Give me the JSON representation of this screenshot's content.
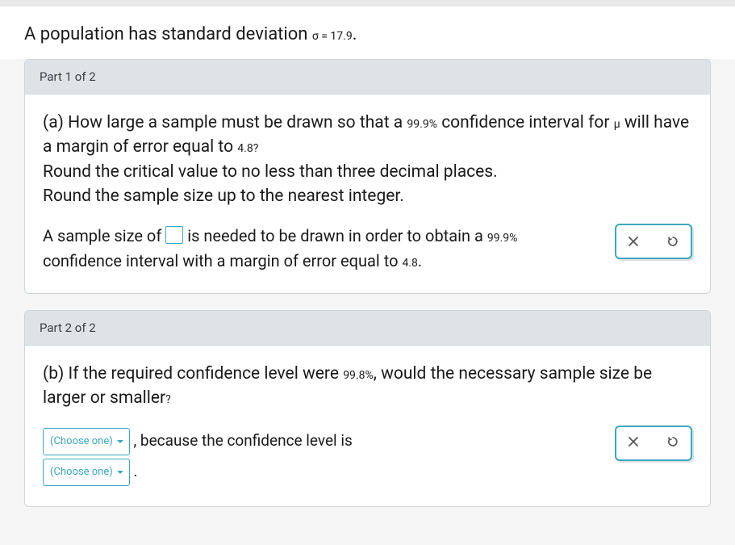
{
  "intro": {
    "prefix": "A population has standard deviation ",
    "sigma_expr": "σ = 17.9",
    "suffix": "."
  },
  "part1": {
    "header": "Part 1 of 2",
    "q_line1a": "(a) How large a sample must be drawn so that a ",
    "q_conf": "99.9%",
    "q_line1b": " confidence interval for ",
    "q_mu": "μ",
    "q_line1c": " will have a margin of error equal to ",
    "q_moe": "4.8?",
    "q_line2": "Round the critical value to no less than three decimal places.",
    "q_line3": "Round the sample size up to the nearest integer.",
    "ans_a": "A sample size of ",
    "ans_b": " is needed to be drawn in order to obtain a ",
    "ans_conf": "99.9%",
    "ans_c": " confidence interval with a margin of error equal to ",
    "ans_moe": "4.8",
    "ans_d": "."
  },
  "part2": {
    "header": "Part 2 of 2",
    "q_a": "(b) If the required confidence level were ",
    "q_conf": "99.8%",
    "q_b": ", would the necessary sample size be larger or smaller",
    "q_c": "?",
    "choose": "(Choose one)",
    "mid1": " , because the confidence level is",
    "mid2": " ."
  }
}
